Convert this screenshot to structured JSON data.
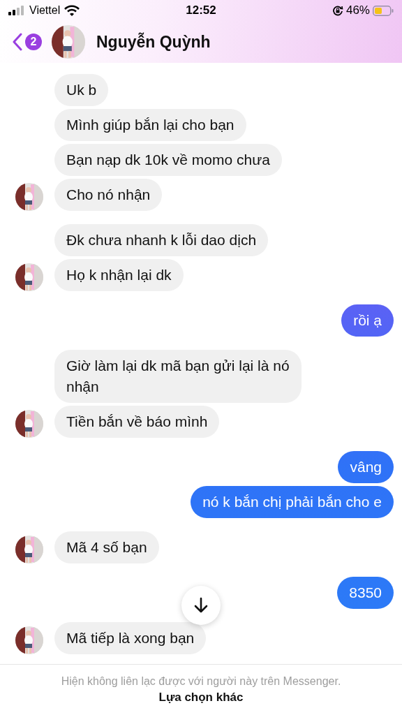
{
  "status_bar": {
    "carrier": "Viettel",
    "time": "12:52",
    "battery": "46%"
  },
  "header": {
    "unread_count": "2",
    "contact_name": "Nguyễn Quỳnh"
  },
  "groups": [
    {
      "kind": "them",
      "messages": [
        "Uk b",
        "Mình giúp bắn lại cho bạn",
        "Bạn nạp dk 10k về momo chưa",
        "Cho nó nhận"
      ]
    },
    {
      "kind": "them",
      "messages": [
        "Đk chưa nhanh k lỗi dao dịch",
        "Họ k nhận lại dk"
      ]
    },
    {
      "kind": "me",
      "messages": [
        "rồi ạ"
      ]
    },
    {
      "kind": "them",
      "messages": [
        "Giờ làm lại dk mã bạn gửi lại là nó nhận",
        "Tiền bắn về báo mình"
      ]
    },
    {
      "kind": "me",
      "messages": [
        "vâng",
        "nó k bắn chị phải bắn cho e"
      ]
    },
    {
      "kind": "them",
      "messages": [
        "Mã 4 số bạn"
      ]
    },
    {
      "kind": "me",
      "messages": [
        "8350"
      ]
    },
    {
      "kind": "them",
      "messages": [
        "Mã tiếp là xong bạn"
      ]
    }
  ],
  "footer": {
    "notice": "Hiện không liên lạc được với người này trên Messenger.",
    "action": "Lựa chọn khác"
  }
}
